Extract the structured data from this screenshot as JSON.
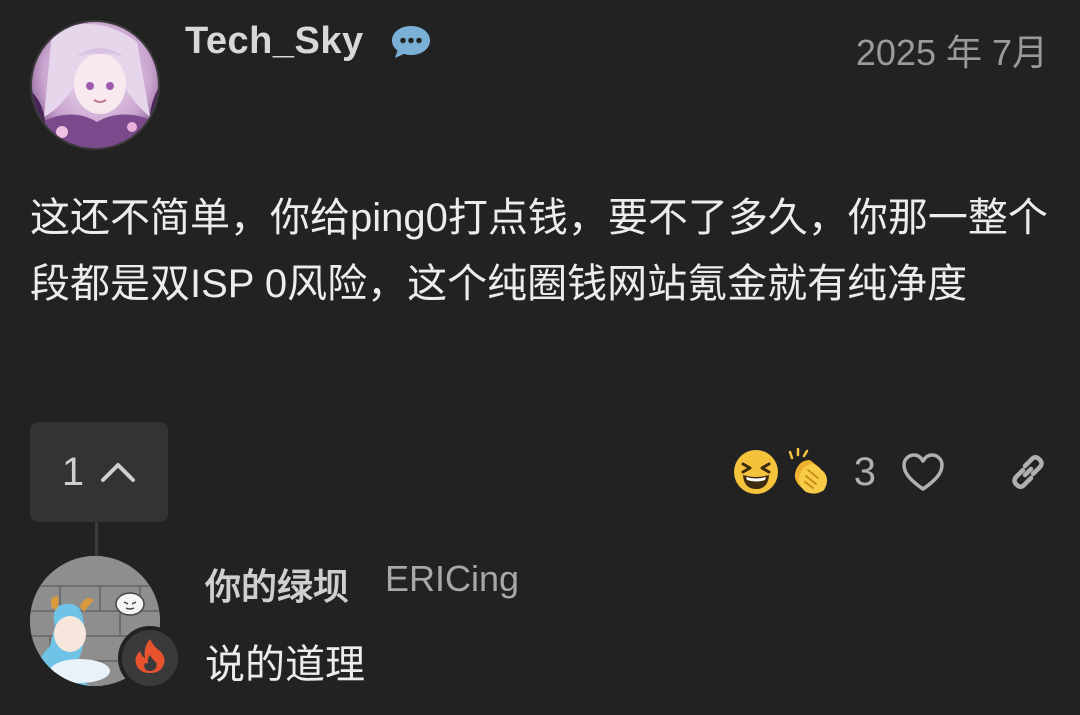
{
  "post": {
    "author": "Tech_Sky",
    "date": "2025 年 7月",
    "body": "这还不简单，你给ping0打点钱，要不了多久，你那一整个段都是双ISP 0风险，这个纯圈钱网站氪金就有纯净度",
    "reply_count": "1",
    "reactions": [
      "grinning-squinting-face-emoji",
      "clapping-hands-emoji"
    ],
    "reaction_count": "3"
  },
  "reply": {
    "display_name": "你的绿坝",
    "username": "ERICing",
    "body": "说的道理"
  },
  "colors": {
    "background": "#222222",
    "button_bg": "#333333",
    "flair_icon": "#e8532f",
    "badge_icon": "#7ab0d6"
  },
  "icons": [
    "chat-bubble-icon",
    "chevron-up-icon",
    "heart-icon",
    "link-icon",
    "fire-icon"
  ]
}
